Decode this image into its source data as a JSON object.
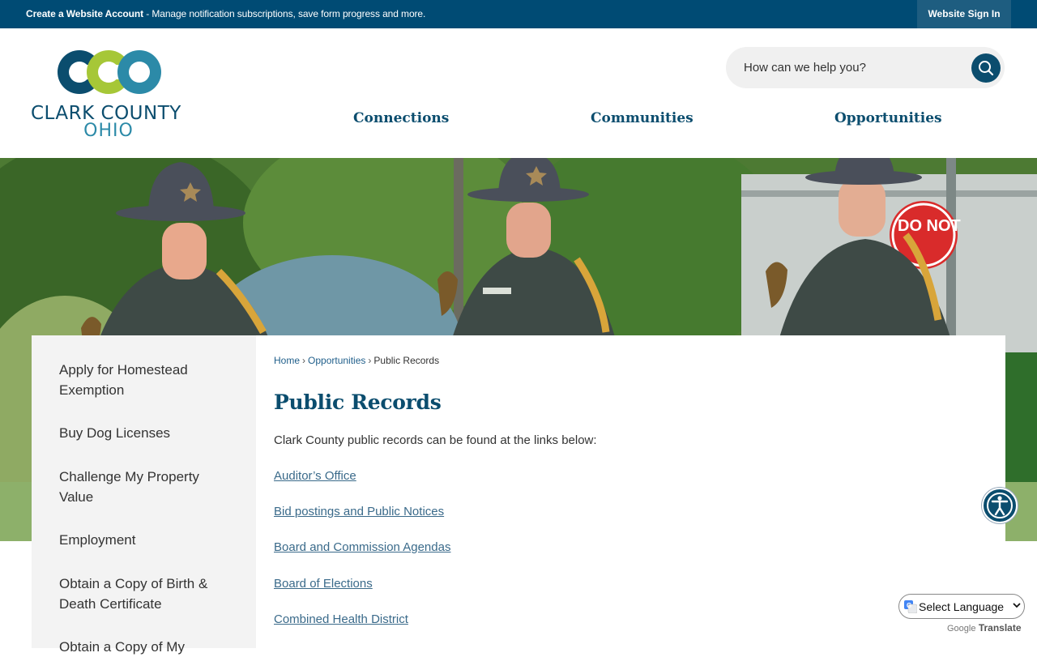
{
  "topbar": {
    "promo_bold": "Create a Website Account",
    "promo_rest": " - Manage notification subscriptions, save form progress and more.",
    "signin_label": "Website Sign In"
  },
  "logo": {
    "line1": "CLARK COUNTY",
    "line2": "OHIO"
  },
  "search": {
    "placeholder": "How can we help you?"
  },
  "nav": {
    "items": [
      {
        "label": "Connections"
      },
      {
        "label": "Communities"
      },
      {
        "label": "Opportunities"
      }
    ]
  },
  "sidebar": {
    "items": [
      {
        "label": "Apply for Homestead Exemption"
      },
      {
        "label": "Buy Dog Licenses"
      },
      {
        "label": "Challenge My Property Value"
      },
      {
        "label": "Employment"
      },
      {
        "label": "Obtain a Copy of Birth & Death Certificate"
      },
      {
        "label": "Obtain a Copy of My"
      }
    ]
  },
  "breadcrumb": {
    "home": "Home",
    "parent": "Opportunities",
    "current": "Public Records",
    "separator": "›"
  },
  "page": {
    "title": "Public Records",
    "intro": "Clark County public records can be found at the links below:",
    "links": [
      {
        "label": "Auditor’s Office"
      },
      {
        "label": "Bid postings and Public Notices"
      },
      {
        "label": "Board and Commission Agendas"
      },
      {
        "label": "Board of Elections"
      },
      {
        "label": "Combined Health District"
      }
    ]
  },
  "translate": {
    "select_label": "Select Language",
    "powered_google": "Google",
    "powered_translate": "Translate"
  },
  "colors": {
    "brand_dark": "#004b74",
    "brand_navy": "#0b4d6e",
    "logo_green": "#a6c737",
    "logo_teal": "#2c8aa8"
  }
}
